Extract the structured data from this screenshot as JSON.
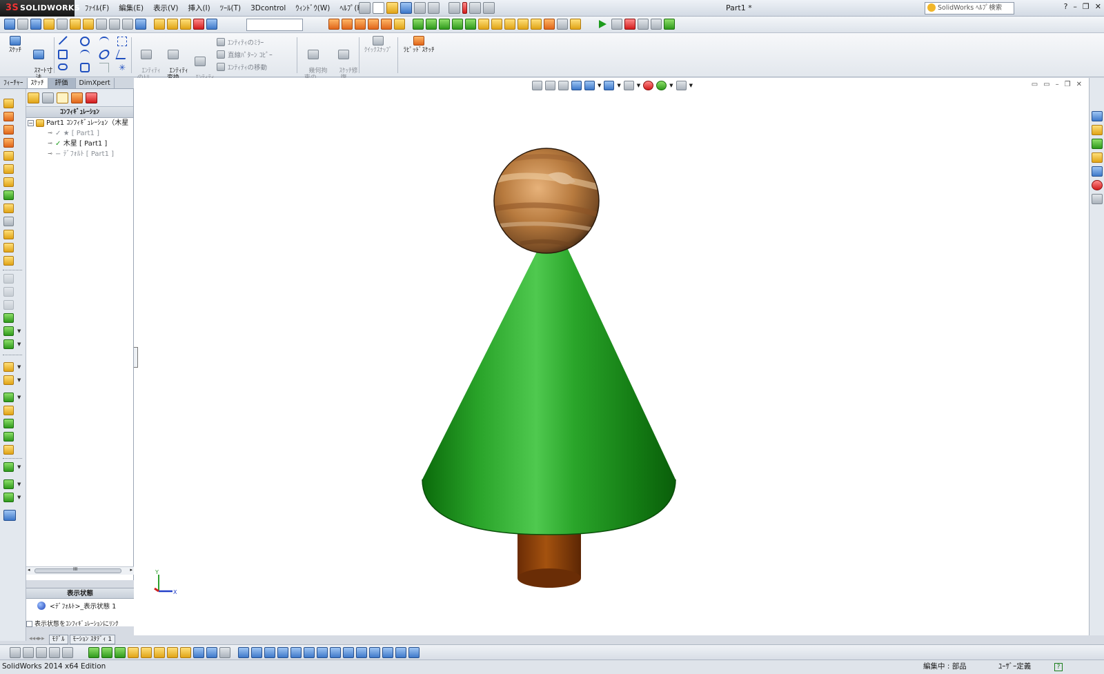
{
  "app": {
    "brand": "SOLIDWORKS",
    "document_title": "Part1 *",
    "help_search_placeholder": "SolidWorks ﾍﾙﾌﾟ検索",
    "window_controls": [
      "?",
      "–",
      "❐",
      "✕"
    ]
  },
  "menu": [
    "ﾌｧｲﾙ(F)",
    "編集(E)",
    "表示(V)",
    "挿入(I)",
    "ﾂｰﾙ(T)",
    "3Dcontrol",
    "ｳｨﾝﾄﾞｳ(W)",
    "ﾍﾙﾌﾟ(H)"
  ],
  "command_manager": {
    "sketch": "ｽｹｯﾁ",
    "smart_dimension": "ｽﾏｰﾄ寸\n法",
    "entity_trim": "ｴﾝﾃｨﾃｨ\nのﾄﾘ...",
    "convert_entities": "ｴﾝﾃｨﾃｨ\n変換",
    "offset_entities": "ｴﾝﾃｨﾃｨ\nｵﾌｾｯﾄ",
    "mirror_entities": "ｴﾝﾃｨﾃｨのﾐﾗｰ",
    "linear_pattern": "直線ﾊﾟﾀｰﾝ ｺﾋﾟｰ",
    "move_entities": "ｴﾝﾃｨﾃｨの移動",
    "display_relations": "幾何拘\n束の...",
    "repair_sketch": "ｽｹｯﾁ修\n復",
    "quick_snaps": "ｸｲｯｸｽﾅｯﾌﾟ",
    "rapid_sketch": "ﾗﾋﾟｯﾄﾞｽｹｯﾁ"
  },
  "tabs": [
    {
      "label": "ﾌｨｰﾁｬｰ",
      "state": "normal"
    },
    {
      "label": "ｽｹｯﾁ",
      "state": "active"
    },
    {
      "label": "評価",
      "state": "sel"
    },
    {
      "label": "DimXpert",
      "state": "normal"
    }
  ],
  "config_manager": {
    "title": "ｺﾝﾌｨｷﾞｭﾚｰｼｮﾝ",
    "root": "Part1 ｺﾝﾌｨｷﾞｭﾚｰｼｮﾝ（木星",
    "items": [
      {
        "label": "★ [ Part1 ]",
        "active": false
      },
      {
        "label": "木星 [ Part1 ]",
        "active": true
      },
      {
        "label": "ﾃﾞﾌｫﾙﾄ [ Part1 ]",
        "active": false
      }
    ],
    "scroll_label": "III"
  },
  "display_states": {
    "title": "表示状態",
    "item": "<ﾃﾞﾌｫﾙﾄ>_表示状態 1",
    "link_checkbox": "表示状態をｺﾝﾌｨｷﾞｭﾚｰｼｮﾝにﾘﾝｸ",
    "link_checked": false
  },
  "bottom_tabs": [
    "ﾓﾃﾞﾙ",
    "ﾓｰｼｮﾝ ｽﾀﾃﾞｨ 1"
  ],
  "triad": {
    "y": "Y",
    "x": "X"
  },
  "status": {
    "edition": "SolidWorks 2014 x64 Edition",
    "editing": "編集中 : 部品",
    "units": "ﾕｰｻﾞｰ定義",
    "help": "?"
  },
  "colors": {
    "cone_green": "#1f9a1f",
    "trunk_brown": "#8a3d0c",
    "sphere_jupiter": "#b77a3e",
    "viewport_bg": "#ffffff"
  }
}
